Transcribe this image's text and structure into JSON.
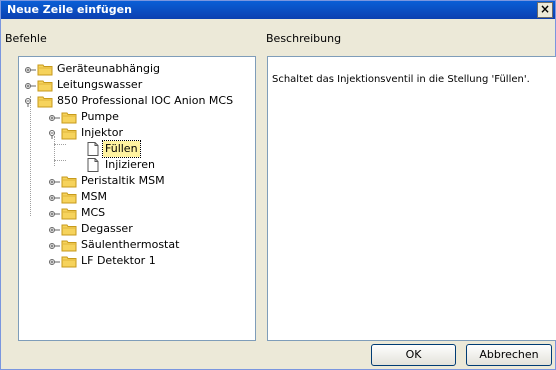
{
  "dialog": {
    "title": "Neue Zeile einfügen",
    "close": "×"
  },
  "labels": {
    "commands": "Befehle",
    "description": "Beschreibung"
  },
  "description_text": "Schaltet das Injektionsventil in die Stellung 'Füllen'.",
  "tree": [
    {
      "label": "Geräteunabhängig",
      "level": 0,
      "icon": "folder-icon",
      "state": "collapsed"
    },
    {
      "label": "Leitungswasser",
      "level": 0,
      "icon": "folder-icon",
      "state": "collapsed"
    },
    {
      "label": "850 Professional IOC Anion MCS",
      "level": 0,
      "icon": "folder-icon",
      "state": "expanded"
    },
    {
      "label": "Pumpe",
      "level": 1,
      "icon": "folder-icon",
      "state": "collapsed"
    },
    {
      "label": "Injektor",
      "level": 1,
      "icon": "folder-icon",
      "state": "expanded"
    },
    {
      "label": "Füllen",
      "level": 2,
      "icon": "document-icon",
      "state": "leaf",
      "selected": true
    },
    {
      "label": "Injizieren",
      "level": 2,
      "icon": "document-icon",
      "state": "leaf"
    },
    {
      "label": "Peristaltik MSM",
      "level": 1,
      "icon": "folder-icon",
      "state": "collapsed"
    },
    {
      "label": "MSM",
      "level": 1,
      "icon": "folder-icon",
      "state": "collapsed"
    },
    {
      "label": "MCS",
      "level": 1,
      "icon": "folder-icon",
      "state": "collapsed"
    },
    {
      "label": "Degasser",
      "level": 1,
      "icon": "folder-icon",
      "state": "collapsed"
    },
    {
      "label": "Säulenthermostat",
      "level": 1,
      "icon": "folder-icon",
      "state": "collapsed"
    },
    {
      "label": "LF Detektor 1",
      "level": 1,
      "icon": "folder-icon",
      "state": "collapsed"
    }
  ],
  "buttons": {
    "ok": "OK",
    "cancel": "Abbrechen"
  }
}
